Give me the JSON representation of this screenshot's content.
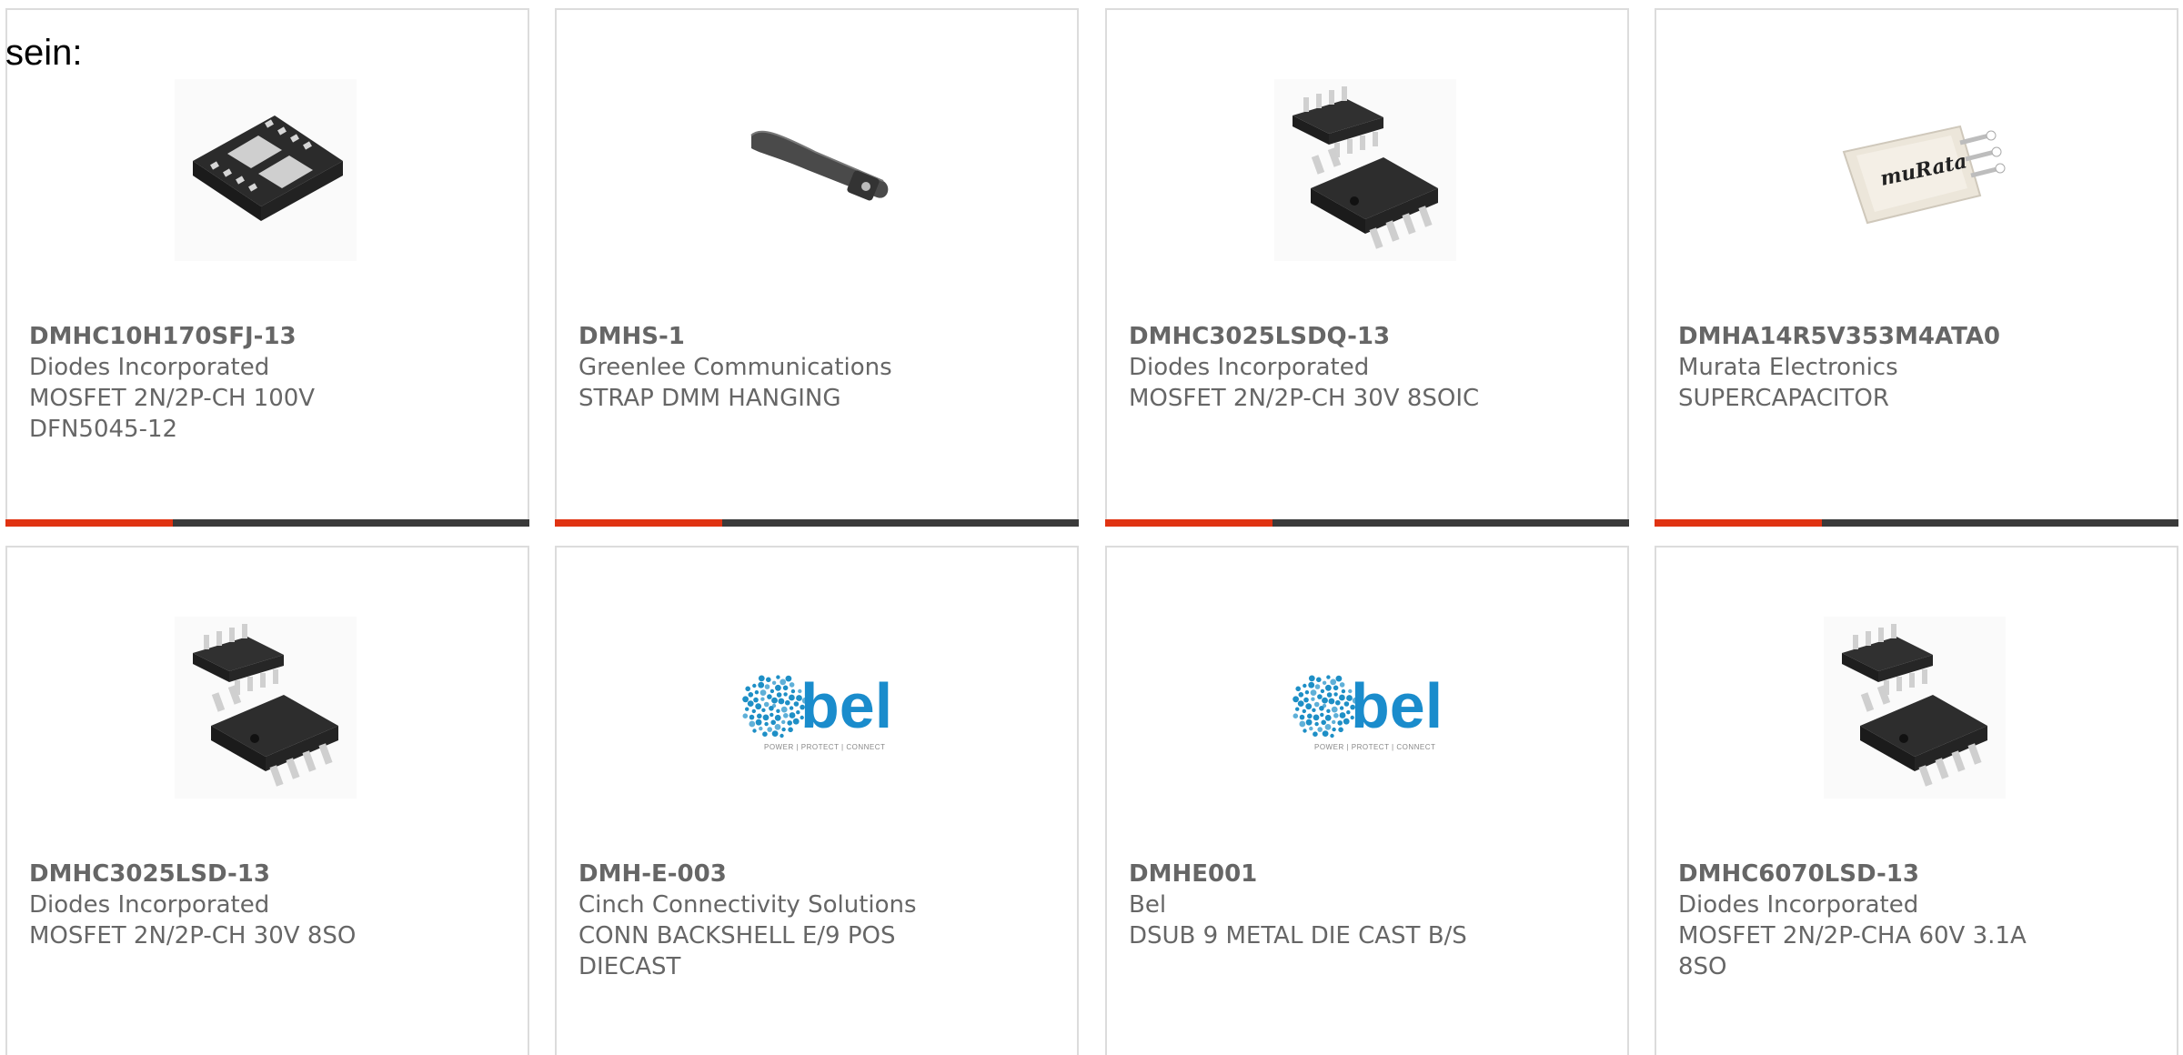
{
  "intro_text": "sein:",
  "accent_color": "#e03312",
  "bar_color": "#3a3a3a",
  "products": [
    {
      "mpn": "DMHC10H170SFJ-13",
      "manufacturer": "Diodes Incorporated",
      "description_lines": [
        "MOSFET 2N/2P-CH 100V",
        "DFN5045-12"
      ],
      "image": "dfn-chip-image"
    },
    {
      "mpn": "DMHS-1",
      "manufacturer": "Greenlee Communications",
      "description_lines": [
        "STRAP DMM HANGING"
      ],
      "image": "strap-image"
    },
    {
      "mpn": "DMHC3025LSDQ-13",
      "manufacturer": "Diodes Incorporated",
      "description_lines": [
        "MOSFET 2N/2P-CH 30V 8SOIC"
      ],
      "image": "soic-chip-image"
    },
    {
      "mpn": "DMHA14R5V353M4ATA0",
      "manufacturer": "Murata Electronics",
      "description_lines": [
        "SUPERCAPACITOR"
      ],
      "image": "murata-supercap-image",
      "image_text": "muRata"
    },
    {
      "mpn": "DMHC3025LSD-13",
      "manufacturer": "Diodes Incorporated",
      "description_lines": [
        "MOSFET 2N/2P-CH 30V 8SO"
      ],
      "image": "soic-chip-image"
    },
    {
      "mpn": "DMH-E-003",
      "manufacturer": "Cinch Connectivity Solutions",
      "description_lines": [
        "CONN BACKSHELL E/9 POS",
        "DIECAST"
      ],
      "image": "bel-logo-image",
      "image_text": "bel",
      "image_tagline": "POWER | PROTECT | CONNECT"
    },
    {
      "mpn": "DMHE001",
      "manufacturer": "Bel",
      "description_lines": [
        "DSUB 9 METAL DIE CAST B/S"
      ],
      "image": "bel-logo-image",
      "image_text": "bel",
      "image_tagline": "POWER | PROTECT | CONNECT"
    },
    {
      "mpn": "DMHC6070LSD-13",
      "manufacturer": "Diodes Incorporated",
      "description_lines": [
        "MOSFET 2N/2P-CHA 60V 3.1A",
        "8SO"
      ],
      "image": "soic-chip-image"
    }
  ]
}
